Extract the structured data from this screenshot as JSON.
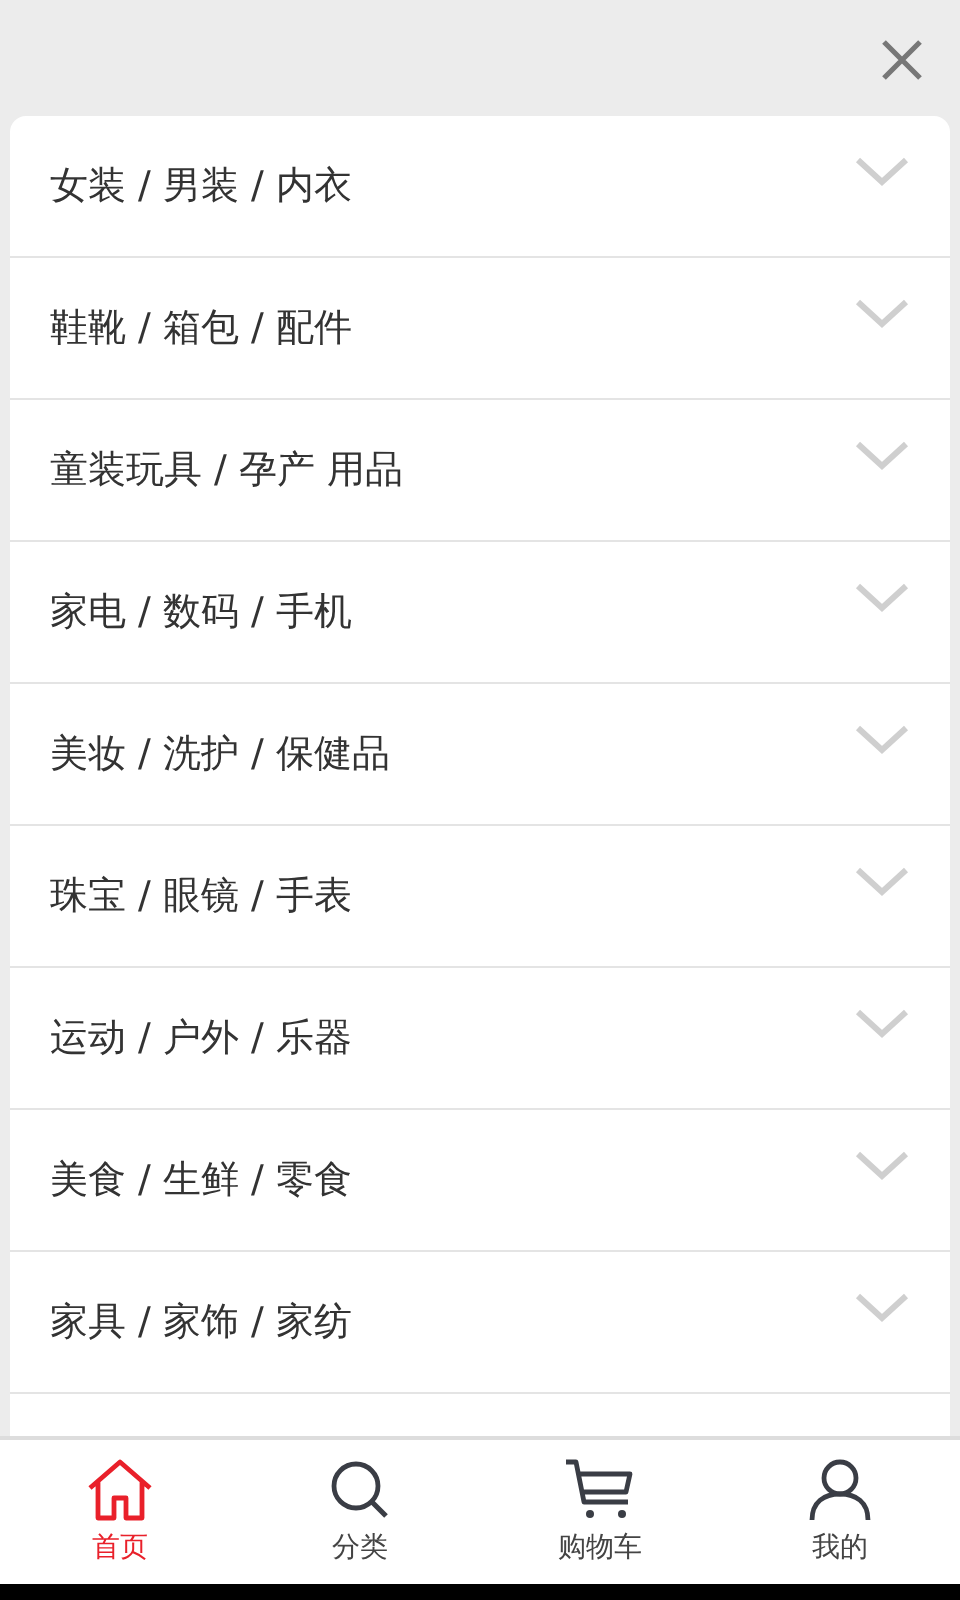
{
  "categories": [
    {
      "label": "女装 / 男装 / 内衣",
      "expanded": false
    },
    {
      "label": "鞋靴 / 箱包 / 配件",
      "expanded": false
    },
    {
      "label": "童装玩具 / 孕产 用品",
      "expanded": false
    },
    {
      "label": "家电 / 数码 / 手机",
      "expanded": false
    },
    {
      "label": "美妆 / 洗护 / 保健品",
      "expanded": false
    },
    {
      "label": "珠宝 / 眼镜 / 手表",
      "expanded": false
    },
    {
      "label": "运动 / 户外 / 乐器",
      "expanded": false
    },
    {
      "label": "美食 / 生鲜 / 零食",
      "expanded": false
    },
    {
      "label": "家具 / 家饰 / 家纺",
      "expanded": false
    }
  ],
  "tab_bar": [
    {
      "kind": "home",
      "label": "首页",
      "selected": true
    },
    {
      "kind": "search",
      "label": "分类",
      "selected": false
    },
    {
      "kind": "cart",
      "label": "购物车",
      "selected": false
    },
    {
      "kind": "user",
      "label": "我的",
      "selected": false
    }
  ]
}
